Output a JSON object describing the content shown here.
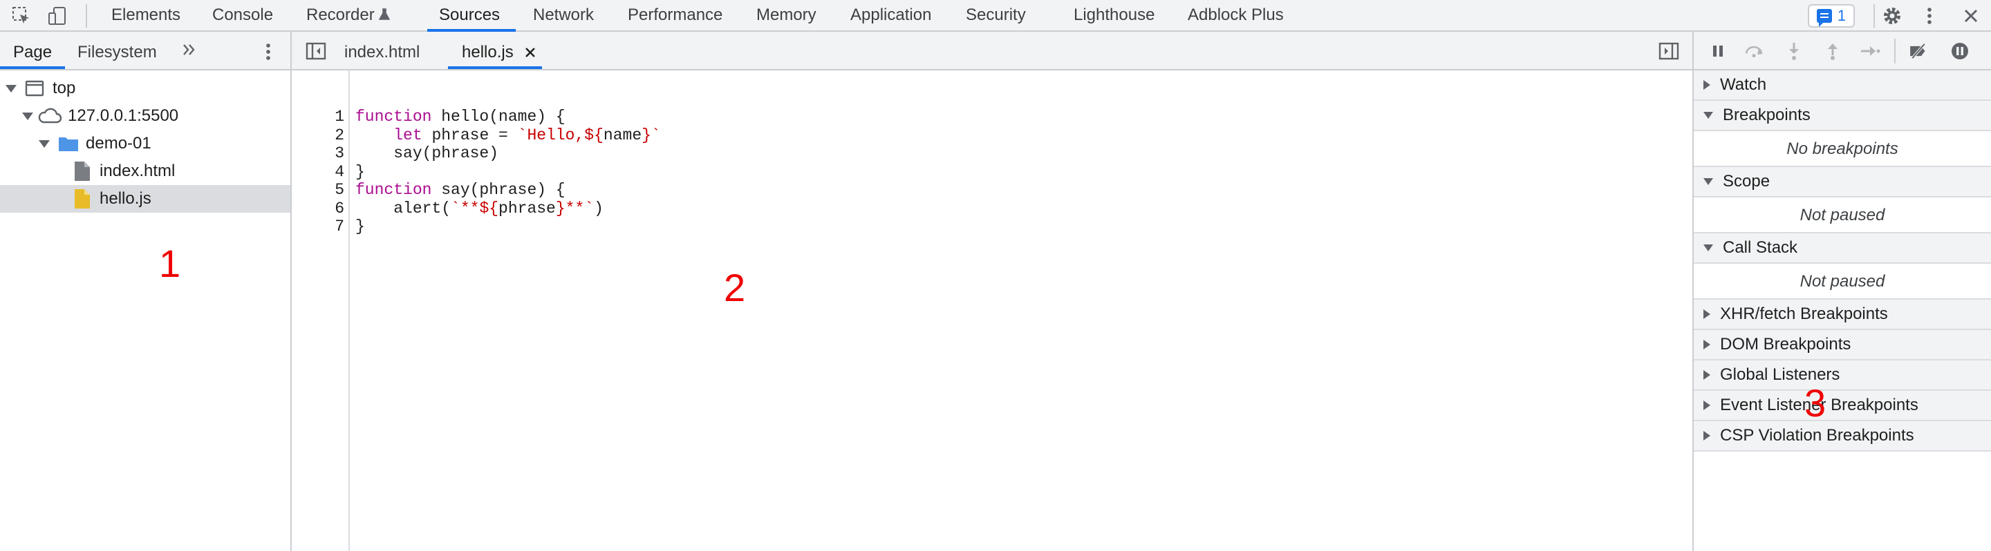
{
  "toolbar": {
    "tabs": [
      "Elements",
      "Console",
      "Recorder",
      "Sources",
      "Network",
      "Performance",
      "Memory",
      "Application",
      "Security",
      "Lighthouse",
      "Adblock Plus"
    ],
    "active_tab": "Sources",
    "issues_count": "1",
    "accent_color": "#1a73e8"
  },
  "navigator": {
    "tabs": [
      "Page",
      "Filesystem"
    ],
    "active_tab": "Page",
    "tree": {
      "top": "top",
      "host": "127.0.0.1:5500",
      "folder": "demo-01",
      "files": [
        "index.html",
        "hello.js"
      ],
      "selected": "hello.js"
    }
  },
  "editor": {
    "tabs": [
      "index.html",
      "hello.js"
    ],
    "active_tab": "hello.js",
    "lines": [
      [
        {
          "t": "function",
          "c": "kw"
        },
        {
          "t": " hello(name) {",
          "c": ""
        }
      ],
      [
        {
          "t": "    ",
          "c": ""
        },
        {
          "t": "let",
          "c": "kw"
        },
        {
          "t": " phrase = ",
          "c": ""
        },
        {
          "t": "`Hello,${",
          "c": "str"
        },
        {
          "t": "name",
          "c": ""
        },
        {
          "t": "}`",
          "c": "str"
        }
      ],
      [
        {
          "t": "    say(phrase)",
          "c": ""
        }
      ],
      [
        {
          "t": "}",
          "c": ""
        }
      ],
      [
        {
          "t": "function",
          "c": "kw"
        },
        {
          "t": " say(phrase) {",
          "c": ""
        }
      ],
      [
        {
          "t": "    alert(",
          "c": ""
        },
        {
          "t": "`**${",
          "c": "str"
        },
        {
          "t": "phrase",
          "c": ""
        },
        {
          "t": "}**`",
          "c": "str"
        },
        {
          "t": ")",
          "c": ""
        }
      ],
      [
        {
          "t": "}",
          "c": ""
        }
      ]
    ]
  },
  "debugger": {
    "sections": {
      "watch": "Watch",
      "breakpoints": "Breakpoints",
      "breakpoints_empty": "No breakpoints",
      "scope": "Scope",
      "scope_empty": "Not paused",
      "call_stack": "Call Stack",
      "call_stack_empty": "Not paused",
      "xhr": "XHR/fetch Breakpoints",
      "dom": "DOM Breakpoints",
      "global": "Global Listeners",
      "event": "Event Listener Breakpoints",
      "csp": "CSP Violation Breakpoints"
    }
  },
  "annotations": [
    "1",
    "2",
    "3"
  ]
}
